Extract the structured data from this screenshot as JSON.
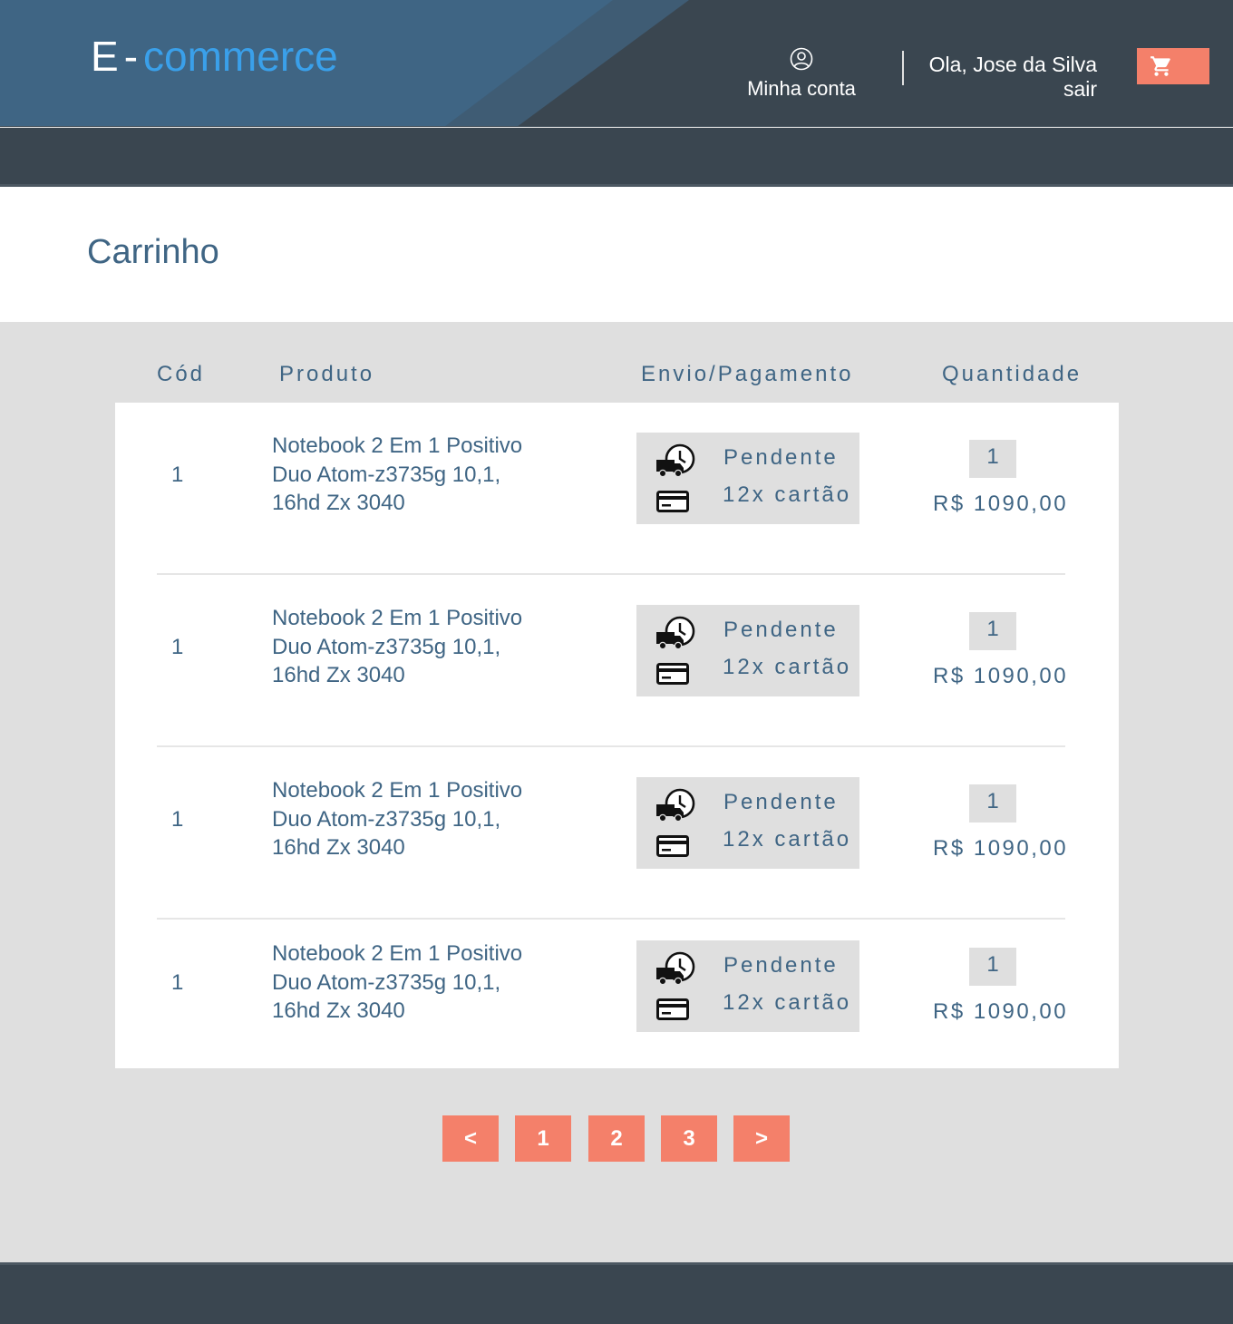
{
  "header": {
    "logo": {
      "part1": "E",
      "dash": "-",
      "part2": "commerce"
    },
    "account_label": "Minha conta",
    "greeting": "Ola, Jose da Silva",
    "logout": "sair",
    "cart_icon": "shopping-cart-icon"
  },
  "colors": {
    "header_bg": "#3a4650",
    "header_band": "#3f6584",
    "accent": "#f4806a",
    "text_blue": "#3f6584",
    "logo_blue": "#3aa0ea",
    "page_bg": "#dfdfdf"
  },
  "page": {
    "title": "Carrinho"
  },
  "table": {
    "headers": {
      "cod": "Cód",
      "produto": "Produto",
      "envio": "Envio/Pagamento",
      "quantidade": "Quantidade"
    },
    "rows": [
      {
        "cod": "1",
        "name_l1": "Notebook 2 Em 1 Positivo",
        "name_l2": "Duo Atom-z3735g 10,1,",
        "name_l3": "16hd Zx 3040",
        "status": "Pendente",
        "payment": "12x cartão",
        "qty": "1",
        "price": "R$ 1090,00"
      },
      {
        "cod": "1",
        "name_l1": "Notebook 2 Em 1 Positivo",
        "name_l2": "Duo Atom-z3735g 10,1,",
        "name_l3": "16hd Zx 3040",
        "status": "Pendente",
        "payment": "12x cartão",
        "qty": "1",
        "price": "R$ 1090,00"
      },
      {
        "cod": "1",
        "name_l1": "Notebook 2 Em 1 Positivo",
        "name_l2": "Duo Atom-z3735g 10,1,",
        "name_l3": "16hd Zx 3040",
        "status": "Pendente",
        "payment": "12x cartão",
        "qty": "1",
        "price": "R$ 1090,00"
      },
      {
        "cod": "1",
        "name_l1": "Notebook 2 Em 1 Positivo",
        "name_l2": "Duo Atom-z3735g 10,1,",
        "name_l3": "16hd Zx 3040",
        "status": "Pendente",
        "payment": "12x cartão",
        "qty": "1",
        "price": "R$ 1090,00"
      }
    ]
  },
  "pagination": {
    "prev": "<",
    "pages": [
      "1",
      "2",
      "3"
    ],
    "next": ">"
  }
}
